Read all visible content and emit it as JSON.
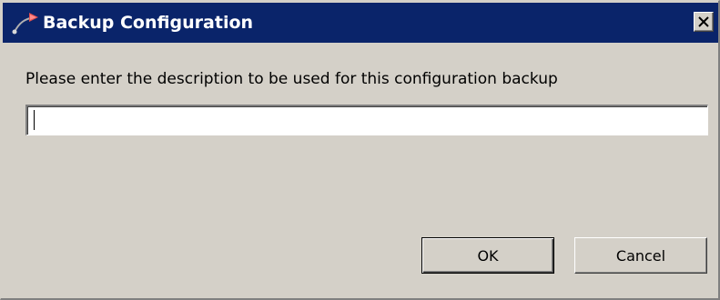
{
  "dialog": {
    "title": "Backup Configuration",
    "close_glyph": "✕",
    "title_icon": "backup-arrow-icon",
    "prompt": "Please enter the description to be used for this configuration backup",
    "description_input": {
      "value": "",
      "placeholder": ""
    },
    "buttons": {
      "ok_label": "OK",
      "cancel_label": "Cancel"
    },
    "colors": {
      "titlebar": "#0a246a",
      "face": "#d4d0c8",
      "title_text": "#ffffff"
    }
  }
}
